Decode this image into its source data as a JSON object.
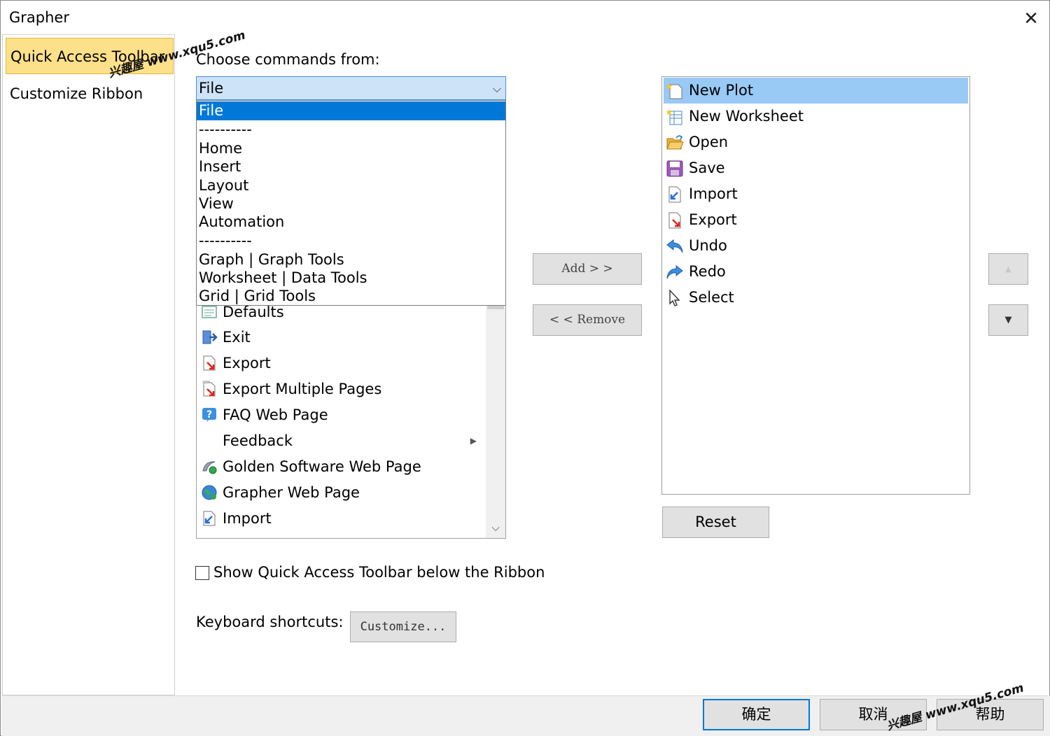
{
  "window": {
    "title": "Grapher",
    "close_glyph": "✕"
  },
  "nav": {
    "items": [
      {
        "label": "Quick Access Toolbar",
        "active": true
      },
      {
        "label": "Customize Ribbon",
        "active": false
      }
    ]
  },
  "choose_label": "Choose commands from:",
  "combo": {
    "value": "File"
  },
  "dropdown_options": [
    "File",
    "----------",
    "Home",
    "Insert",
    "Layout",
    "View",
    "Automation",
    "----------",
    "Graph | Graph Tools",
    "Worksheet | Data Tools",
    "Grid | Grid Tools"
  ],
  "commands": [
    {
      "label": "Defaults",
      "icon": "defaults-icon"
    },
    {
      "label": "Exit",
      "icon": "exit-icon"
    },
    {
      "label": "Export",
      "icon": "export-icon"
    },
    {
      "label": "Export Multiple Pages",
      "icon": "export-multiple-icon"
    },
    {
      "label": "FAQ Web Page",
      "icon": "help-icon"
    },
    {
      "label": "Feedback",
      "icon": "",
      "submenu_glyph": "▶"
    },
    {
      "label": "Golden Software Web Page",
      "icon": "golden-web-icon"
    },
    {
      "label": "Grapher Web Page",
      "icon": "globe-icon"
    },
    {
      "label": "Import",
      "icon": "import-icon"
    }
  ],
  "buttons": {
    "add": "Add  >  >",
    "remove": "<  <  Remove",
    "reset": "Reset",
    "customize": "Customize...",
    "up_glyph": "▲",
    "down_glyph": "▼"
  },
  "qat_items": [
    {
      "label": "New Plot",
      "icon": "new-plot-icon",
      "selected": true
    },
    {
      "label": "New Worksheet",
      "icon": "new-worksheet-icon"
    },
    {
      "label": "Open",
      "icon": "open-folder-icon"
    },
    {
      "label": "Save",
      "icon": "save-icon"
    },
    {
      "label": "Import",
      "icon": "import-icon"
    },
    {
      "label": "Export",
      "icon": "export-icon"
    },
    {
      "label": "Undo",
      "icon": "undo-icon"
    },
    {
      "label": "Redo",
      "icon": "redo-icon"
    },
    {
      "label": "Select",
      "icon": "cursor-icon"
    }
  ],
  "checkbox": {
    "label": "Show Quick Access Toolbar below the Ribbon",
    "checked": false
  },
  "keyboard_label": "Keyboard shortcuts:",
  "footer": {
    "ok": "确定",
    "cancel": "取消",
    "help": "帮助"
  },
  "watermark": {
    "text1": "兴趣屋 www.xqu5.com",
    "text2": "兴趣屋 www.xqu5.com"
  },
  "colors": {
    "nav_active": "#fde08a",
    "combo_bg": "#cde3f8",
    "option_selected": "#0078d7",
    "qat_selected": "#99c9f5"
  },
  "glyphs": {
    "combo_chevron": "⌵",
    "scroll_down": "⌵"
  }
}
